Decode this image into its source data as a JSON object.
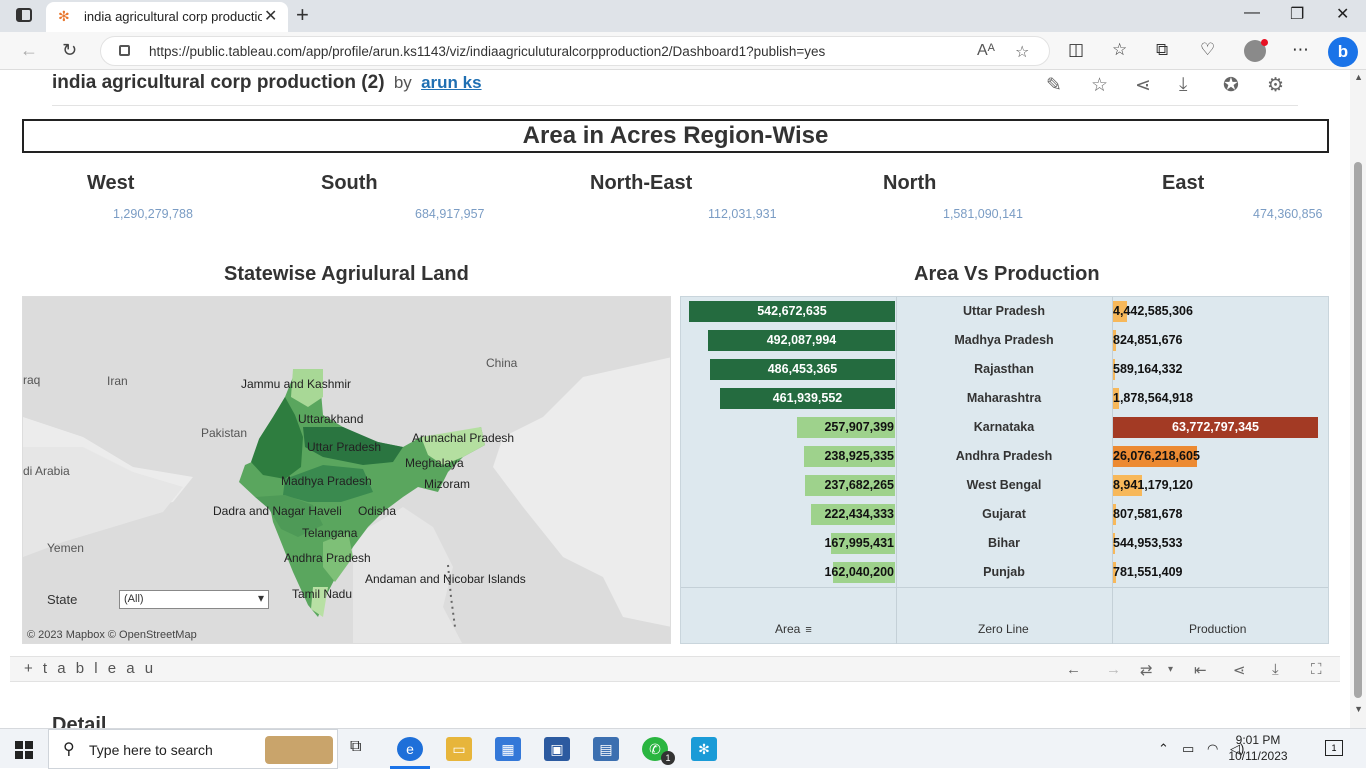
{
  "browser": {
    "tab_title": "india agricultural corp productio",
    "url": "https://public.tableau.com/app/profile/arun.ks1143/viz/indiaagriculuturalcorpproduction2/Dashboard1?publish=yes",
    "url_tail_icons": [
      "read-aloud-icon",
      "favorite-star-icon"
    ]
  },
  "header": {
    "title": "india agricultural corp production (2)",
    "by": "by",
    "author": "arun ks"
  },
  "regions": {
    "banner": "Area in Acres Region-Wise",
    "items": [
      {
        "name": "West",
        "value": "1,290,279,788"
      },
      {
        "name": "South",
        "value": "684,917,957"
      },
      {
        "name": "North-East",
        "value": "112,031,931"
      },
      {
        "name": "North",
        "value": "1,581,090,141"
      },
      {
        "name": "East",
        "value": "474,360,856"
      }
    ]
  },
  "map": {
    "title": "Statewise Agriulural Land",
    "attribution": "© 2023 Mapbox  © OpenStreetMap",
    "filter_label": "State",
    "filter_value": "(All)",
    "labels": {
      "iraq": "raq",
      "iran": "Iran",
      "pakistan": "Pakistan",
      "arabia": "di Arabia",
      "yemen": "Yemen",
      "china": "China",
      "jk": "Jammu and Kashmir",
      "uk": "Uttarakhand",
      "up": "Uttar Pradesh",
      "arunachal": "Arunachal Pradesh",
      "meghalaya": "Meghalaya",
      "mizoram": "Mizoram",
      "mp": "Madhya Pradesh",
      "dnh": "Dadra and Nagar Haveli",
      "odisha": "Odisha",
      "telangana": "Telangana",
      "ap": "Andhra Pradesh",
      "andaman": "Andaman and Nicobar Islands",
      "tn": "Tamil Nadu"
    }
  },
  "chart_data": {
    "type": "bar",
    "title": "Area Vs Production",
    "categories": [
      "Uttar Pradesh",
      "Madhya Pradesh",
      "Rajasthan",
      "Maharashtra",
      "Karnataka",
      "Andhra Pradesh",
      "West Bengal",
      "Gujarat",
      "Bihar",
      "Punjab"
    ],
    "series": [
      {
        "name": "Area",
        "values": [
          542672635,
          492087994,
          486453365,
          461939552,
          257907399,
          238925335,
          237682265,
          222434333,
          167995431,
          162040200
        ],
        "labels": [
          "542,672,635",
          "492,087,994",
          "486,453,365",
          "461,939,552",
          "257,907,399",
          "238,925,335",
          "237,682,265",
          "222,434,333",
          "167,995,431",
          "162,040,200"
        ]
      },
      {
        "name": "Production",
        "values": [
          4442585306,
          824851676,
          589164332,
          1878564918,
          63772797345,
          26076218605,
          8941179120,
          807581678,
          544953533,
          781551409
        ],
        "labels": [
          "4,442,585,306",
          "824,851,676",
          "589,164,332",
          "1,878,564,918",
          "63,772,797,345",
          "26,076,218,605",
          "8,941,179,120",
          "807,581,678",
          "544,953,533",
          "781,551,409"
        ]
      }
    ],
    "axis_labels": [
      "Area",
      "Zero Line",
      "Production"
    ],
    "colors": {
      "area_dark": "#246b3f",
      "area_mid": "#3a8a4f",
      "area_light": "#9ed28c",
      "prod_high": "#a33a24",
      "prod_mid": "#ec8a32",
      "prod_low": "#f7b85a",
      "background": "#dde8ee"
    }
  },
  "toolbar": {
    "logo": "+ t a b l e a u"
  },
  "next_section": "Detail",
  "taskbar": {
    "search_placeholder": "Type here to search",
    "time": "9:01 PM",
    "date": "10/11/2023",
    "notif_count": "1",
    "whatsapp_badge": "1"
  }
}
